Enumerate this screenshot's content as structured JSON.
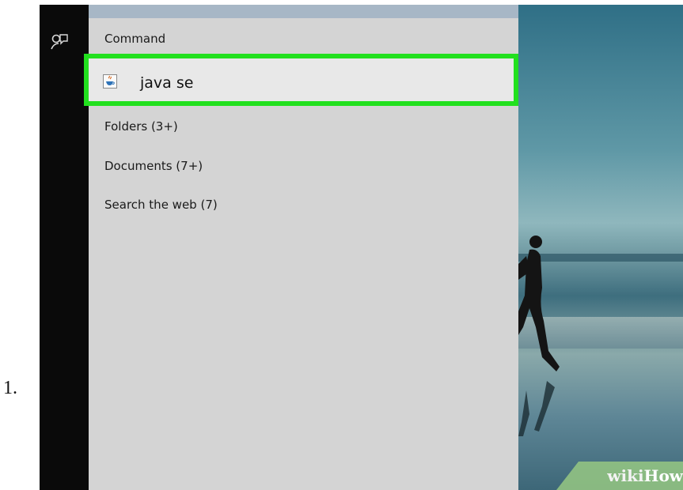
{
  "step": {
    "number": "1."
  },
  "rail": {
    "icon": "feedback-person-icon"
  },
  "search_panel": {
    "top_group_header": "Command",
    "best_match": {
      "label": "java se",
      "icon": "java-app-icon",
      "highlight_color": "#22e01e"
    },
    "categories": [
      {
        "label": "Folders (3+)"
      },
      {
        "label": "Documents (7+)"
      },
      {
        "label": "Search the web (7)"
      }
    ]
  },
  "watermark": {
    "wiki": "wiki",
    "how": "How"
  }
}
